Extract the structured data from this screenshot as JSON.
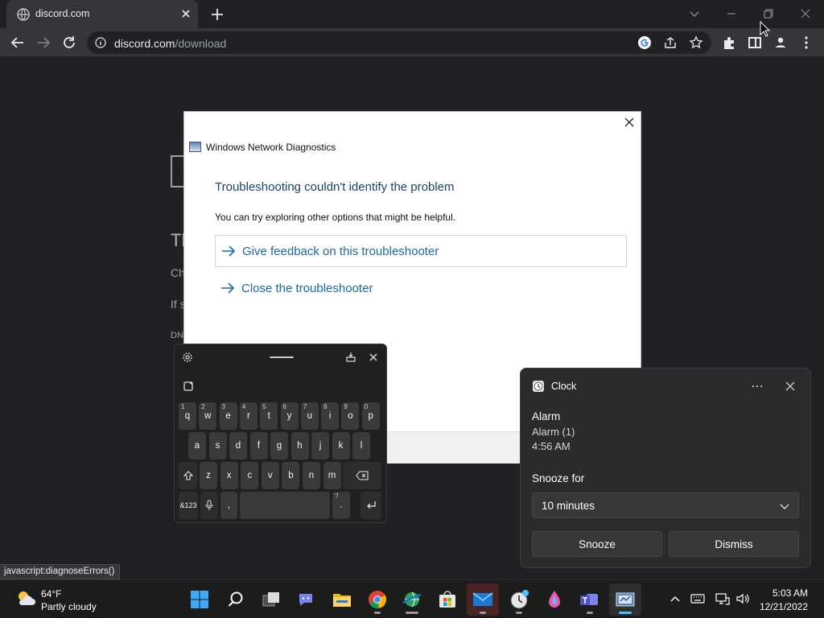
{
  "browser": {
    "tab_title": "discord.com",
    "url_host": "discord.com",
    "url_path": "/download"
  },
  "page_fragments": [
    "Tl",
    "Ch",
    "If s",
    "DN"
  ],
  "dialog": {
    "title": "Windows Network Diagnostics",
    "heading": "Troubleshooting couldn't identify the problem",
    "subtitle": "You can try exploring other options that might be helpful.",
    "options": [
      "Give feedback on this troubleshooter",
      "Close the troubleshooter"
    ]
  },
  "keyboard": {
    "row1": [
      [
        "q",
        "1"
      ],
      [
        "w",
        "2"
      ],
      [
        "e",
        "3"
      ],
      [
        "r",
        "4"
      ],
      [
        "t",
        "5"
      ],
      [
        "y",
        "6"
      ],
      [
        "u",
        "7"
      ],
      [
        "i",
        "8"
      ],
      [
        "o",
        "9"
      ],
      [
        "p",
        "0"
      ]
    ],
    "row2": [
      "a",
      "s",
      "d",
      "f",
      "g",
      "h",
      "j",
      "k",
      "l"
    ],
    "row3": [
      "z",
      "x",
      "c",
      "v",
      "b",
      "n",
      "m"
    ],
    "symbols_key": "&123",
    "comma": ",",
    "period": ".",
    "period_alt": "?"
  },
  "notification": {
    "app": "Clock",
    "title": "Alarm",
    "lines": [
      "Alarm (1)",
      "4:56 AM"
    ],
    "snooze_label": "Snooze for",
    "snooze_value": "10 minutes",
    "buttons": [
      "Snooze",
      "Dismiss"
    ]
  },
  "status_link": "javascript:diagnoseErrors()",
  "taskbar": {
    "temperature": "64°F",
    "condition": "Partly cloudy",
    "time": "5:03 AM",
    "date": "12/21/2022"
  }
}
